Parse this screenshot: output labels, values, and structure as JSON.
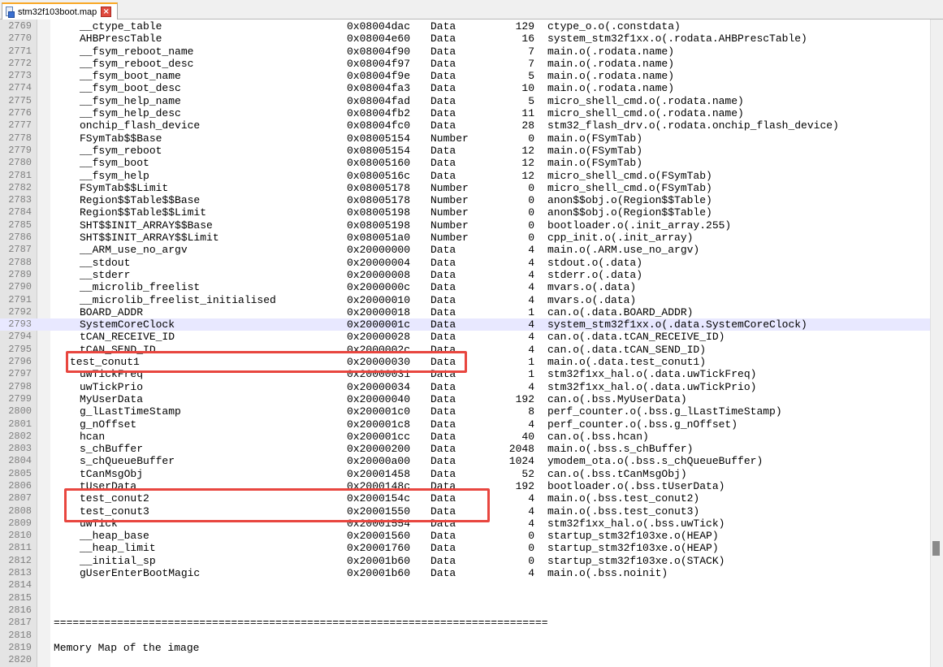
{
  "tab": {
    "title": "stm32f103boot.map",
    "icon": "document-save-icon",
    "close_icon": "close-icon",
    "close_glyph": "×"
  },
  "colors": {
    "current_line_bg": "#e8e8ff",
    "annotation_red": "#e8463f",
    "line_number": "#808080"
  },
  "lines": [
    {
      "n": "2769",
      "name": "__ctype_table",
      "addr": "0x08004dac",
      "type": "Data",
      "size": "129",
      "obj": "ctype_o.o(.constdata)"
    },
    {
      "n": "2770",
      "name": "AHBPrescTable",
      "addr": "0x08004e60",
      "type": "Data",
      "size": "16",
      "obj": "system_stm32f1xx.o(.rodata.AHBPrescTable)"
    },
    {
      "n": "2771",
      "name": "__fsym_reboot_name",
      "addr": "0x08004f90",
      "type": "Data",
      "size": "7",
      "obj": "main.o(.rodata.name)"
    },
    {
      "n": "2772",
      "name": "__fsym_reboot_desc",
      "addr": "0x08004f97",
      "type": "Data",
      "size": "7",
      "obj": "main.o(.rodata.name)"
    },
    {
      "n": "2773",
      "name": "__fsym_boot_name",
      "addr": "0x08004f9e",
      "type": "Data",
      "size": "5",
      "obj": "main.o(.rodata.name)"
    },
    {
      "n": "2774",
      "name": "__fsym_boot_desc",
      "addr": "0x08004fa3",
      "type": "Data",
      "size": "10",
      "obj": "main.o(.rodata.name)"
    },
    {
      "n": "2775",
      "name": "__fsym_help_name",
      "addr": "0x08004fad",
      "type": "Data",
      "size": "5",
      "obj": "micro_shell_cmd.o(.rodata.name)"
    },
    {
      "n": "2776",
      "name": "__fsym_help_desc",
      "addr": "0x08004fb2",
      "type": "Data",
      "size": "11",
      "obj": "micro_shell_cmd.o(.rodata.name)"
    },
    {
      "n": "2777",
      "name": "onchip_flash_device",
      "addr": "0x08004fc0",
      "type": "Data",
      "size": "28",
      "obj": "stm32_flash_drv.o(.rodata.onchip_flash_device)"
    },
    {
      "n": "2778",
      "name": "FSymTab$$Base",
      "addr": "0x08005154",
      "type": "Number",
      "size": "0",
      "obj": "main.o(FSymTab)"
    },
    {
      "n": "2779",
      "name": "__fsym_reboot",
      "addr": "0x08005154",
      "type": "Data",
      "size": "12",
      "obj": "main.o(FSymTab)"
    },
    {
      "n": "2780",
      "name": "__fsym_boot",
      "addr": "0x08005160",
      "type": "Data",
      "size": "12",
      "obj": "main.o(FSymTab)"
    },
    {
      "n": "2781",
      "name": "__fsym_help",
      "addr": "0x0800516c",
      "type": "Data",
      "size": "12",
      "obj": "micro_shell_cmd.o(FSymTab)"
    },
    {
      "n": "2782",
      "name": "FSymTab$$Limit",
      "addr": "0x08005178",
      "type": "Number",
      "size": "0",
      "obj": "micro_shell_cmd.o(FSymTab)"
    },
    {
      "n": "2783",
      "name": "Region$$Table$$Base",
      "addr": "0x08005178",
      "type": "Number",
      "size": "0",
      "obj": "anon$$obj.o(Region$$Table)"
    },
    {
      "n": "2784",
      "name": "Region$$Table$$Limit",
      "addr": "0x08005198",
      "type": "Number",
      "size": "0",
      "obj": "anon$$obj.o(Region$$Table)"
    },
    {
      "n": "2785",
      "name": "SHT$$INIT_ARRAY$$Base",
      "addr": "0x08005198",
      "type": "Number",
      "size": "0",
      "obj": "bootloader.o(.init_array.255)"
    },
    {
      "n": "2786",
      "name": "SHT$$INIT_ARRAY$$Limit",
      "addr": "0x080051a0",
      "type": "Number",
      "size": "0",
      "obj": "cpp_init.o(.init_array)"
    },
    {
      "n": "2787",
      "name": "__ARM_use_no_argv",
      "addr": "0x20000000",
      "type": "Data",
      "size": "4",
      "obj": "main.o(.ARM.use_no_argv)"
    },
    {
      "n": "2788",
      "name": "__stdout",
      "addr": "0x20000004",
      "type": "Data",
      "size": "4",
      "obj": "stdout.o(.data)"
    },
    {
      "n": "2789",
      "name": "__stderr",
      "addr": "0x20000008",
      "type": "Data",
      "size": "4",
      "obj": "stderr.o(.data)"
    },
    {
      "n": "2790",
      "name": "__microlib_freelist",
      "addr": "0x2000000c",
      "type": "Data",
      "size": "4",
      "obj": "mvars.o(.data)"
    },
    {
      "n": "2791",
      "name": "__microlib_freelist_initialised",
      "addr": "0x20000010",
      "type": "Data",
      "size": "4",
      "obj": "mvars.o(.data)"
    },
    {
      "n": "2792",
      "name": "BOARD_ADDR",
      "addr": "0x20000018",
      "type": "Data",
      "size": "1",
      "obj": "can.o(.data.BOARD_ADDR)"
    },
    {
      "n": "2793",
      "name": "SystemCoreClock",
      "addr": "0x2000001c",
      "type": "Data",
      "size": "4",
      "obj": "system_stm32f1xx.o(.data.SystemCoreClock)",
      "current": true
    },
    {
      "n": "2794",
      "name": "tCAN_RECEIVE_ID",
      "addr": "0x20000028",
      "type": "Data",
      "size": "4",
      "obj": "can.o(.data.tCAN_RECEIVE_ID)"
    },
    {
      "n": "2795",
      "name": "tCAN_SEND_ID",
      "addr": "0x2000002c",
      "type": "Data",
      "size": "4",
      "obj": "can.o(.data.tCAN_SEND_ID)"
    },
    {
      "n": "2796",
      "name": "test_conut1",
      "addr": "0x20000030",
      "type": "Data",
      "size": "1",
      "obj": "main.o(.data.test_conut1)",
      "shift": true
    },
    {
      "n": "2797",
      "name": "uwTickFreq",
      "addr": "0x20000031",
      "type": "Data",
      "size": "1",
      "obj": "stm32f1xx_hal.o(.data.uwTickFreq)"
    },
    {
      "n": "2798",
      "name": "uwTickPrio",
      "addr": "0x20000034",
      "type": "Data",
      "size": "4",
      "obj": "stm32f1xx_hal.o(.data.uwTickPrio)"
    },
    {
      "n": "2799",
      "name": "MyUserData",
      "addr": "0x20000040",
      "type": "Data",
      "size": "192",
      "obj": "can.o(.bss.MyUserData)"
    },
    {
      "n": "2800",
      "name": "g_lLastTimeStamp",
      "addr": "0x200001c0",
      "type": "Data",
      "size": "8",
      "obj": "perf_counter.o(.bss.g_lLastTimeStamp)"
    },
    {
      "n": "2801",
      "name": "g_nOffset",
      "addr": "0x200001c8",
      "type": "Data",
      "size": "4",
      "obj": "perf_counter.o(.bss.g_nOffset)"
    },
    {
      "n": "2802",
      "name": "hcan",
      "addr": "0x200001cc",
      "type": "Data",
      "size": "40",
      "obj": "can.o(.bss.hcan)"
    },
    {
      "n": "2803",
      "name": "s_chBuffer",
      "addr": "0x20000200",
      "type": "Data",
      "size": "2048",
      "obj": "main.o(.bss.s_chBuffer)"
    },
    {
      "n": "2804",
      "name": "s_chQueueBuffer",
      "addr": "0x20000a00",
      "type": "Data",
      "size": "1024",
      "obj": "ymodem_ota.o(.bss.s_chQueueBuffer)"
    },
    {
      "n": "2805",
      "name": "tCanMsgObj",
      "addr": "0x20001458",
      "type": "Data",
      "size": "52",
      "obj": "can.o(.bss.tCanMsgObj)"
    },
    {
      "n": "2806",
      "name": "tUserData",
      "addr": "0x2000148c",
      "type": "Data",
      "size": "192",
      "obj": "bootloader.o(.bss.tUserData)"
    },
    {
      "n": "2807",
      "name": "test_conut2",
      "addr": "0x2000154c",
      "type": "Data",
      "size": "4",
      "obj": "main.o(.bss.test_conut2)"
    },
    {
      "n": "2808",
      "name": "test_conut3",
      "addr": "0x20001550",
      "type": "Data",
      "size": "4",
      "obj": "main.o(.bss.test_conut3)"
    },
    {
      "n": "2809",
      "name": "uwTick",
      "addr": "0x20001554",
      "type": "Data",
      "size": "4",
      "obj": "stm32f1xx_hal.o(.bss.uwTick)"
    },
    {
      "n": "2810",
      "name": "__heap_base",
      "addr": "0x20001560",
      "type": "Data",
      "size": "0",
      "obj": "startup_stm32f103xe.o(HEAP)"
    },
    {
      "n": "2811",
      "name": "__heap_limit",
      "addr": "0x20001760",
      "type": "Data",
      "size": "0",
      "obj": "startup_stm32f103xe.o(HEAP)"
    },
    {
      "n": "2812",
      "name": "__initial_sp",
      "addr": "0x20001b60",
      "type": "Data",
      "size": "0",
      "obj": "startup_stm32f103xe.o(STACK)"
    },
    {
      "n": "2813",
      "name": "gUserEnterBootMagic",
      "addr": "0x20001b60",
      "type": "Data",
      "size": "4",
      "obj": "main.o(.bss.noinit)"
    },
    {
      "n": "2814"
    },
    {
      "n": "2815"
    },
    {
      "n": "2816"
    },
    {
      "n": "2817",
      "text": "=============================================================================="
    },
    {
      "n": "2818"
    },
    {
      "n": "2819",
      "text": "Memory Map of the image"
    },
    {
      "n": "2820"
    }
  ]
}
